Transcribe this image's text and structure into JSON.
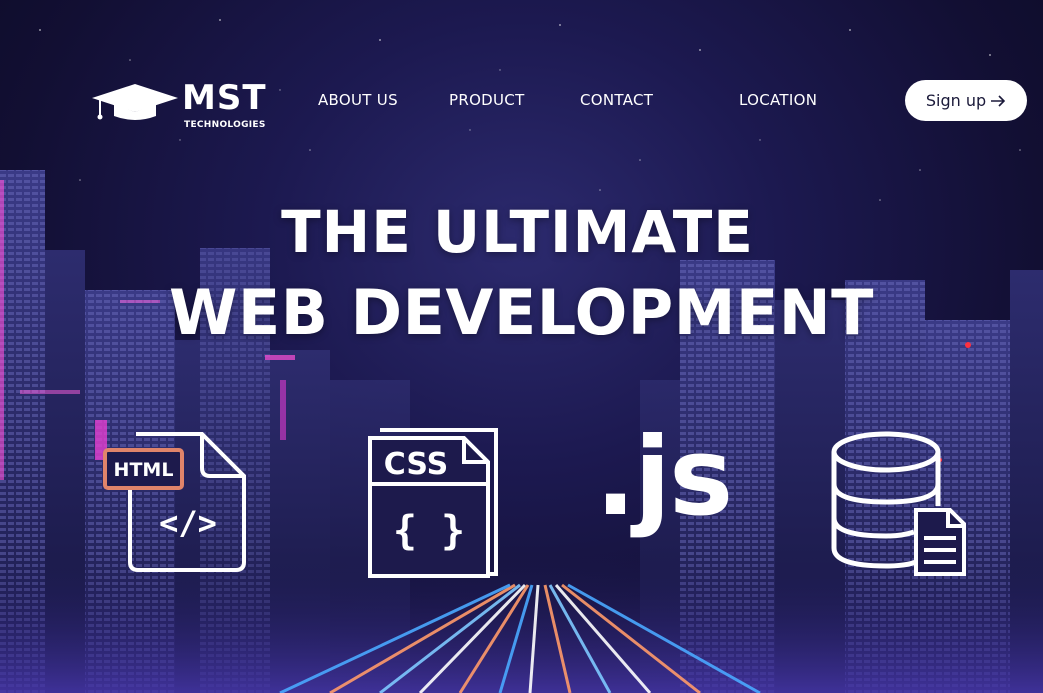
{
  "brand": {
    "name": "MST",
    "subtitle": "TECHNOLOGIES"
  },
  "nav": {
    "items": [
      {
        "label": "ABOUT US"
      },
      {
        "label": "PRODUCT"
      },
      {
        "label": "CONTACT"
      },
      {
        "label": "LOCATION"
      }
    ],
    "signup_label": "Sign up",
    "signup_icon": "arrow-right-icon"
  },
  "hero": {
    "line1": "THE ULTIMATE",
    "line2": "WEB DEVELOPMENT"
  },
  "tech": {
    "html_label": "HTML",
    "html_code": "</>",
    "css_label": "CSS",
    "css_braces": "{ }",
    "js_label": ".js",
    "database_icon": "database-document-icon"
  },
  "colors": {
    "background": "#1c1950",
    "html_badge": "#e0846a",
    "accent_pink": "#d63fd0",
    "accent_blue": "#4aa8ff",
    "signup_bg": "#ffffff"
  }
}
